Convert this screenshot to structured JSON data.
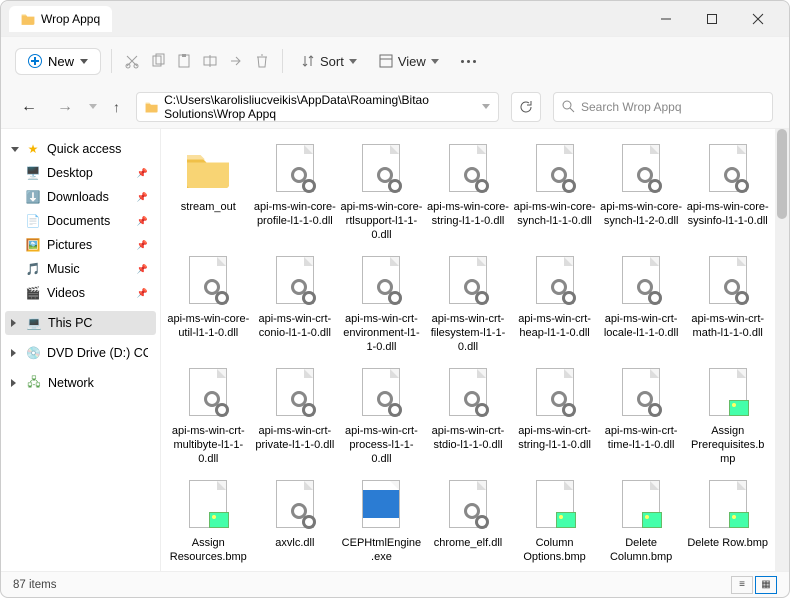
{
  "window": {
    "title": "Wrop Appq"
  },
  "toolbar": {
    "new_label": "New",
    "sort_label": "Sort",
    "view_label": "View"
  },
  "address": {
    "path": "C:\\Users\\karolisliucveikis\\AppData\\Roaming\\Bitao Solutions\\Wrop Appq"
  },
  "search": {
    "placeholder": "Search Wrop Appq"
  },
  "sidebar": {
    "quick_access": "Quick access",
    "items": [
      {
        "label": "Desktop",
        "pinned": true
      },
      {
        "label": "Downloads",
        "pinned": true
      },
      {
        "label": "Documents",
        "pinned": true
      },
      {
        "label": "Pictures",
        "pinned": true
      },
      {
        "label": "Music",
        "pinned": true
      },
      {
        "label": "Videos",
        "pinned": true
      }
    ],
    "this_pc": "This PC",
    "dvd": "DVD Drive (D:) CCCC",
    "network": "Network"
  },
  "files": [
    {
      "name": "stream_out",
      "type": "folder"
    },
    {
      "name": "api-ms-win-core-profile-l1-1-0.dll",
      "type": "dll"
    },
    {
      "name": "api-ms-win-core-rtlsupport-l1-1-0.dll",
      "type": "dll"
    },
    {
      "name": "api-ms-win-core-string-l1-1-0.dll",
      "type": "dll"
    },
    {
      "name": "api-ms-win-core-synch-l1-1-0.dll",
      "type": "dll"
    },
    {
      "name": "api-ms-win-core-synch-l1-2-0.dll",
      "type": "dll"
    },
    {
      "name": "api-ms-win-core-sysinfo-l1-1-0.dll",
      "type": "dll"
    },
    {
      "name": "api-ms-win-core-util-l1-1-0.dll",
      "type": "dll"
    },
    {
      "name": "api-ms-win-crt-conio-l1-1-0.dll",
      "type": "dll"
    },
    {
      "name": "api-ms-win-crt-environment-l1-1-0.dll",
      "type": "dll"
    },
    {
      "name": "api-ms-win-crt-filesystem-l1-1-0.dll",
      "type": "dll"
    },
    {
      "name": "api-ms-win-crt-heap-l1-1-0.dll",
      "type": "dll"
    },
    {
      "name": "api-ms-win-crt-locale-l1-1-0.dll",
      "type": "dll"
    },
    {
      "name": "api-ms-win-crt-math-l1-1-0.dll",
      "type": "dll"
    },
    {
      "name": "api-ms-win-crt-multibyte-l1-1-0.dll",
      "type": "dll"
    },
    {
      "name": "api-ms-win-crt-private-l1-1-0.dll",
      "type": "dll"
    },
    {
      "name": "api-ms-win-crt-process-l1-1-0.dll",
      "type": "dll"
    },
    {
      "name": "api-ms-win-crt-stdio-l1-1-0.dll",
      "type": "dll"
    },
    {
      "name": "api-ms-win-crt-string-l1-1-0.dll",
      "type": "dll"
    },
    {
      "name": "api-ms-win-crt-time-l1-1-0.dll",
      "type": "dll"
    },
    {
      "name": "Assign Prerequisites.bmp",
      "type": "bmp"
    },
    {
      "name": "Assign Resources.bmp",
      "type": "bmp"
    },
    {
      "name": "axvlc.dll",
      "type": "dll"
    },
    {
      "name": "CEPHtmlEngine.exe",
      "type": "exe"
    },
    {
      "name": "chrome_elf.dll",
      "type": "dll"
    },
    {
      "name": "Column Options.bmp",
      "type": "bmp"
    },
    {
      "name": "Delete Column.bmp",
      "type": "bmp"
    },
    {
      "name": "Delete Row.bmp",
      "type": "bmp"
    }
  ],
  "status": {
    "count_label": "87 items"
  }
}
